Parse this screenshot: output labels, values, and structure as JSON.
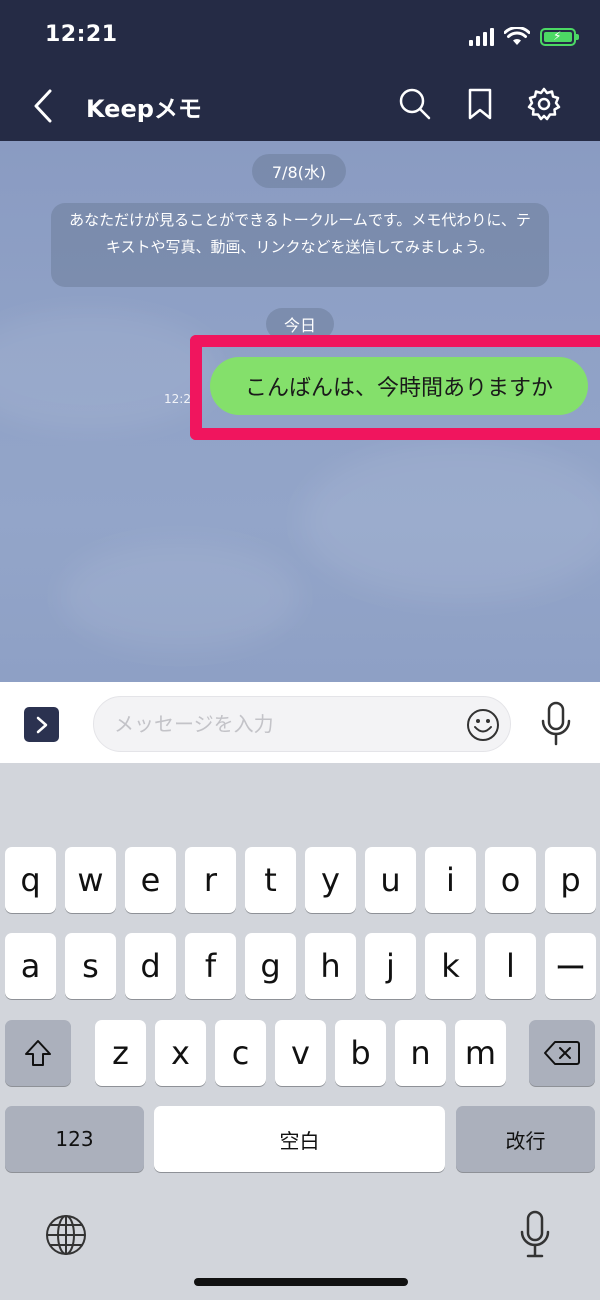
{
  "status_bar": {
    "time": "12:21"
  },
  "nav": {
    "title": "Keepメモ"
  },
  "chat": {
    "date": "7/8(水)",
    "system_message": "あなただけが見ることができるトークルームです。メモ代わりに、テキストや写真、動画、リンクなどを送信してみましょう。",
    "today": "今日",
    "message_time": "12:21",
    "message_text": "こんばんは、今時間ありますか"
  },
  "input": {
    "placeholder": "メッセージを入力"
  },
  "keyboard": {
    "row1": [
      "q",
      "w",
      "e",
      "r",
      "t",
      "y",
      "u",
      "i",
      "o",
      "p"
    ],
    "row2": [
      "a",
      "s",
      "d",
      "f",
      "g",
      "h",
      "j",
      "k",
      "l",
      "ー"
    ],
    "row3": [
      "z",
      "x",
      "c",
      "v",
      "b",
      "n",
      "m"
    ],
    "numbers_label": "123",
    "space_label": "空白",
    "return_label": "改行"
  },
  "colors": {
    "header_bg": "#252b45",
    "bubble_green": "#84e06b",
    "highlight": "#f0155e",
    "battery": "#4cd964"
  }
}
